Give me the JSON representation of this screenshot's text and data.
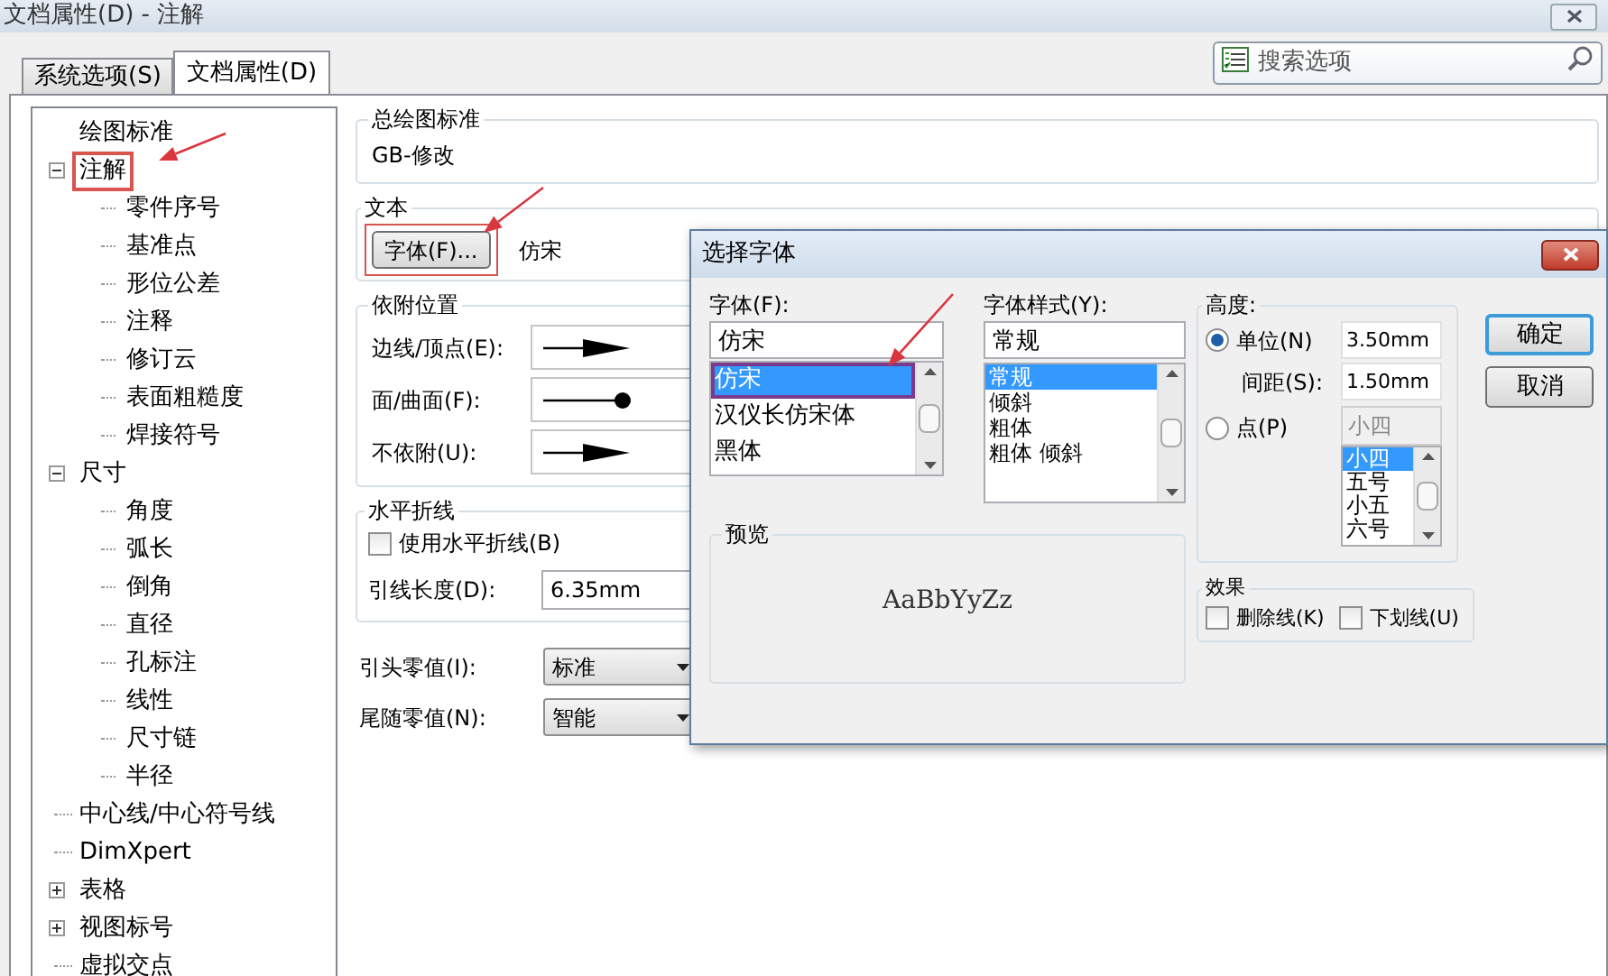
{
  "window": {
    "title": "文档属性(D) - 注解"
  },
  "tabs": [
    {
      "label": "系统选项(S)",
      "selected": false
    },
    {
      "label": "文档属性(D)",
      "selected": true
    }
  ],
  "search": {
    "placeholder": "搜索选项"
  },
  "tree": [
    {
      "label": "绘图标准",
      "highlighted": false
    },
    {
      "label": "注解",
      "highlighted": true,
      "expanded": true,
      "children": [
        {
          "label": "零件序号"
        },
        {
          "label": "基准点"
        },
        {
          "label": "形位公差"
        },
        {
          "label": "注释"
        },
        {
          "label": "修订云"
        },
        {
          "label": "表面粗糙度"
        },
        {
          "label": "焊接符号"
        }
      ]
    },
    {
      "label": "尺寸",
      "highlighted": false,
      "expanded": true,
      "children": [
        {
          "label": "角度"
        },
        {
          "label": "弧长"
        },
        {
          "label": "倒角"
        },
        {
          "label": "直径"
        },
        {
          "label": "孔标注"
        },
        {
          "label": "线性"
        },
        {
          "label": "尺寸链"
        },
        {
          "label": "半径"
        }
      ]
    },
    {
      "label": "中心线/中心符号线",
      "highlighted": false
    },
    {
      "label": "DimXpert",
      "highlighted": false
    },
    {
      "label": "表格",
      "highlighted": false,
      "expanded": false
    },
    {
      "label": "视图标号",
      "highlighted": false,
      "expanded": false
    },
    {
      "label": "虚拟交点",
      "highlighted": false
    }
  ],
  "general_standard": {
    "label": "总绘图标准",
    "value": "GB-修改"
  },
  "text_group": {
    "label": "文本",
    "font_button": {
      "label": "字体(F)...",
      "highlighted": true
    },
    "font_name": "仿宋"
  },
  "attachment": {
    "label": "依附位置",
    "rows": [
      {
        "label": "边线/顶点(E):",
        "kind": "arrow"
      },
      {
        "label": "面/曲面(F):",
        "kind": "dot"
      },
      {
        "label": "不依附(U):",
        "kind": "arrow"
      }
    ]
  },
  "bent_leader": {
    "label": "水平折线",
    "checkbox": {
      "label": "使用水平折线(B)",
      "checked": false
    },
    "length": {
      "label": "引线长度(D):",
      "value": "6.35mm"
    }
  },
  "zeros": [
    {
      "label": "引头零值(I):",
      "value": "标准"
    },
    {
      "label": "尾随零值(N):",
      "value": "智能"
    }
  ],
  "font_dialog": {
    "title": "选择字体",
    "font": {
      "label": "字体(F):",
      "value": "仿宋",
      "options": [
        {
          "label": "仿宋",
          "selected": true
        },
        {
          "label": "汉仪长仿宋体",
          "selected": false
        },
        {
          "label": "黑体",
          "selected": false
        }
      ]
    },
    "style": {
      "label": "字体样式(Y):",
      "value": "常规",
      "options": [
        {
          "label": "常规",
          "selected": true
        },
        {
          "label": "倾斜",
          "selected": false
        },
        {
          "label": "粗体",
          "selected": false
        },
        {
          "label": "粗体 倾斜",
          "selected": false
        }
      ]
    },
    "height": {
      "label": "高度:",
      "unit": {
        "label": "单位(N)",
        "selected": true,
        "value": "3.50mm"
      },
      "spacing": {
        "label": "间距(S):",
        "value": "1.50mm"
      },
      "point": {
        "label": "点(P)",
        "selected": false,
        "value": "小四",
        "options": [
          {
            "label": "小四",
            "selected": true
          },
          {
            "label": "五号",
            "selected": false
          },
          {
            "label": "小五",
            "selected": false
          },
          {
            "label": "六号",
            "selected": false
          }
        ]
      }
    },
    "preview": {
      "label": "预览",
      "sample": "AaBbYyZz"
    },
    "effects": {
      "label": "效果",
      "items": [
        {
          "label": "删除线(K)",
          "checked": false
        },
        {
          "label": "下划线(U)",
          "checked": false
        }
      ]
    },
    "buttons": [
      {
        "label": "确定",
        "default": true
      },
      {
        "label": "取消",
        "default": false
      }
    ]
  }
}
